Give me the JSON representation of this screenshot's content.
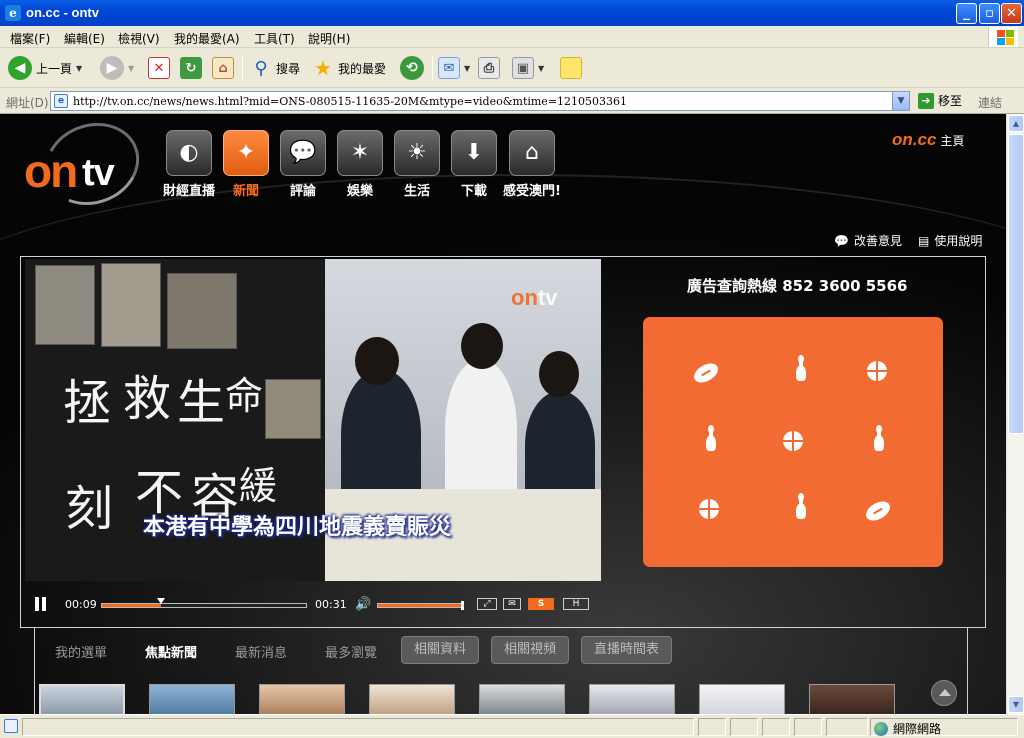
{
  "window": {
    "title": "on.cc - ontv"
  },
  "menu": [
    "檔案(F)",
    "編輯(E)",
    "檢視(V)",
    "我的最愛(A)",
    "工具(T)",
    "說明(H)"
  ],
  "toolbar": {
    "back": "上一頁",
    "search": "搜尋",
    "favorites": "我的最愛"
  },
  "address": {
    "label": "網址(D)",
    "url": "http://tv.on.cc/news/news.html?mid=ONS-080515-11635-20M&mtype=video&mtime=1210503361",
    "go": "移至",
    "links": "連結"
  },
  "status": {
    "zone": "網際網路"
  },
  "site": {
    "logo_on": "on",
    "logo_tv": "tv",
    "brand": "on.cc",
    "home": "主頁",
    "nav": [
      {
        "label": "財經直播",
        "icon": "satellite-dish-icon"
      },
      {
        "label": "新聞",
        "icon": "compass-icon"
      },
      {
        "label": "評論",
        "icon": "speech-bubble-icon"
      },
      {
        "label": "娛樂",
        "icon": "stars-icon"
      },
      {
        "label": "生活",
        "icon": "sun-icon"
      },
      {
        "label": "下載",
        "icon": "download-icon"
      },
      {
        "label": "感受澳門!",
        "icon": "macau-icon"
      }
    ],
    "active_nav": "新聞",
    "feedback": "改善意見",
    "help": "使用說明"
  },
  "player": {
    "board_chars": [
      "拯",
      "救",
      "生",
      "命",
      "刻",
      "不",
      "容",
      "緩"
    ],
    "watermark_on": "on",
    "watermark_tv": "tv",
    "subtitle": "本港有中學為四川地震義賣賑災",
    "current_time": "00:09",
    "duration": "00:31",
    "progress": 0.29,
    "volume": 1.0,
    "btn_s": "S",
    "btn_h": "H"
  },
  "ad": {
    "hotline": "廣告查詢熱線 852 3600 5566",
    "color": "#f26b32"
  },
  "tabs": {
    "text_tabs": [
      "我的選單",
      "焦點新聞",
      "最新消息",
      "最多瀏覽"
    ],
    "active_tab": "焦點新聞",
    "button_tabs": [
      "相關資料",
      "相關視頻",
      "直播時間表"
    ]
  },
  "colors": {
    "accent": "#f26b1d",
    "xp_blue": "#0046d5"
  }
}
